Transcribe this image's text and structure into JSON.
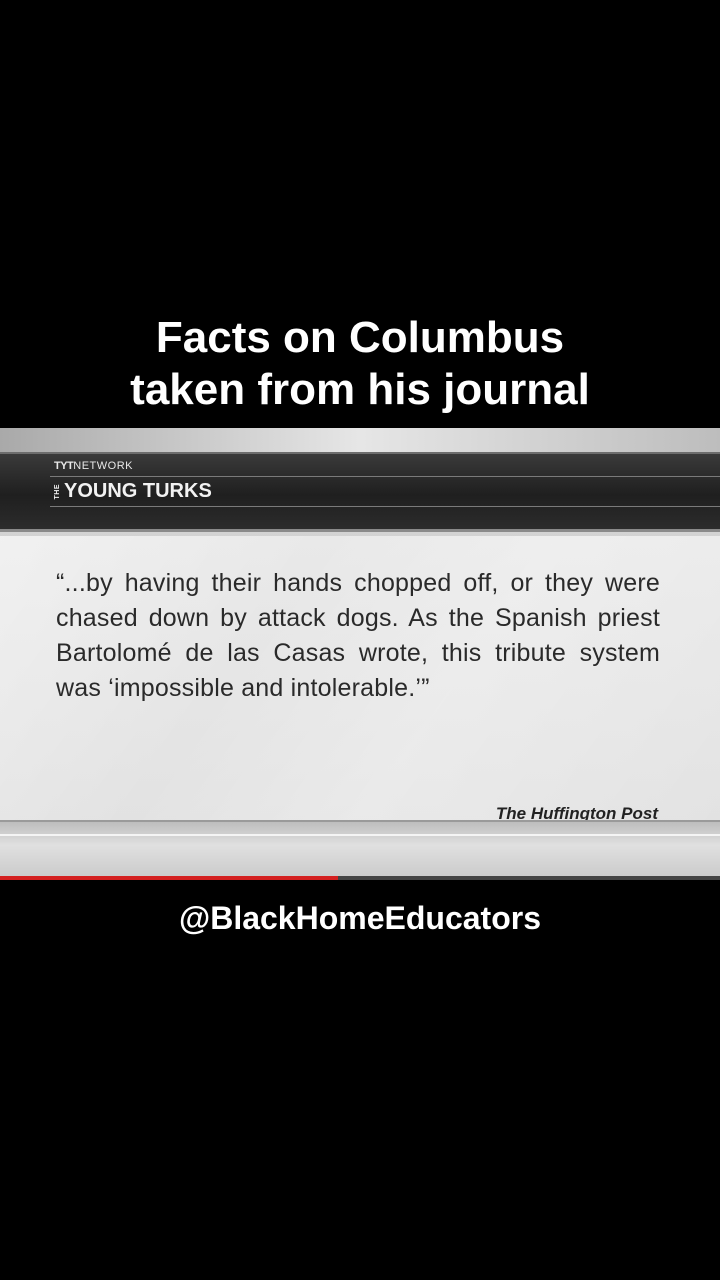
{
  "headline": {
    "line1": "Facts on Columbus",
    "line2": "taken from his journal"
  },
  "video": {
    "network_bold": "TYT",
    "network_rest": "NETWORK",
    "show_prefix": "THE",
    "show_name": "YOUNG TURKS",
    "quote": "“...by having their hands chopped off, or they were chased down by attack dogs. As the Spanish priest Bartolomé de las Casas wrote, this tribute system was ‘impossible and intolerable.’”",
    "source": "The Huffington Post",
    "progress_fraction": 0.47,
    "progress_color": "#d42020"
  },
  "handle": "@BlackHomeEducators"
}
